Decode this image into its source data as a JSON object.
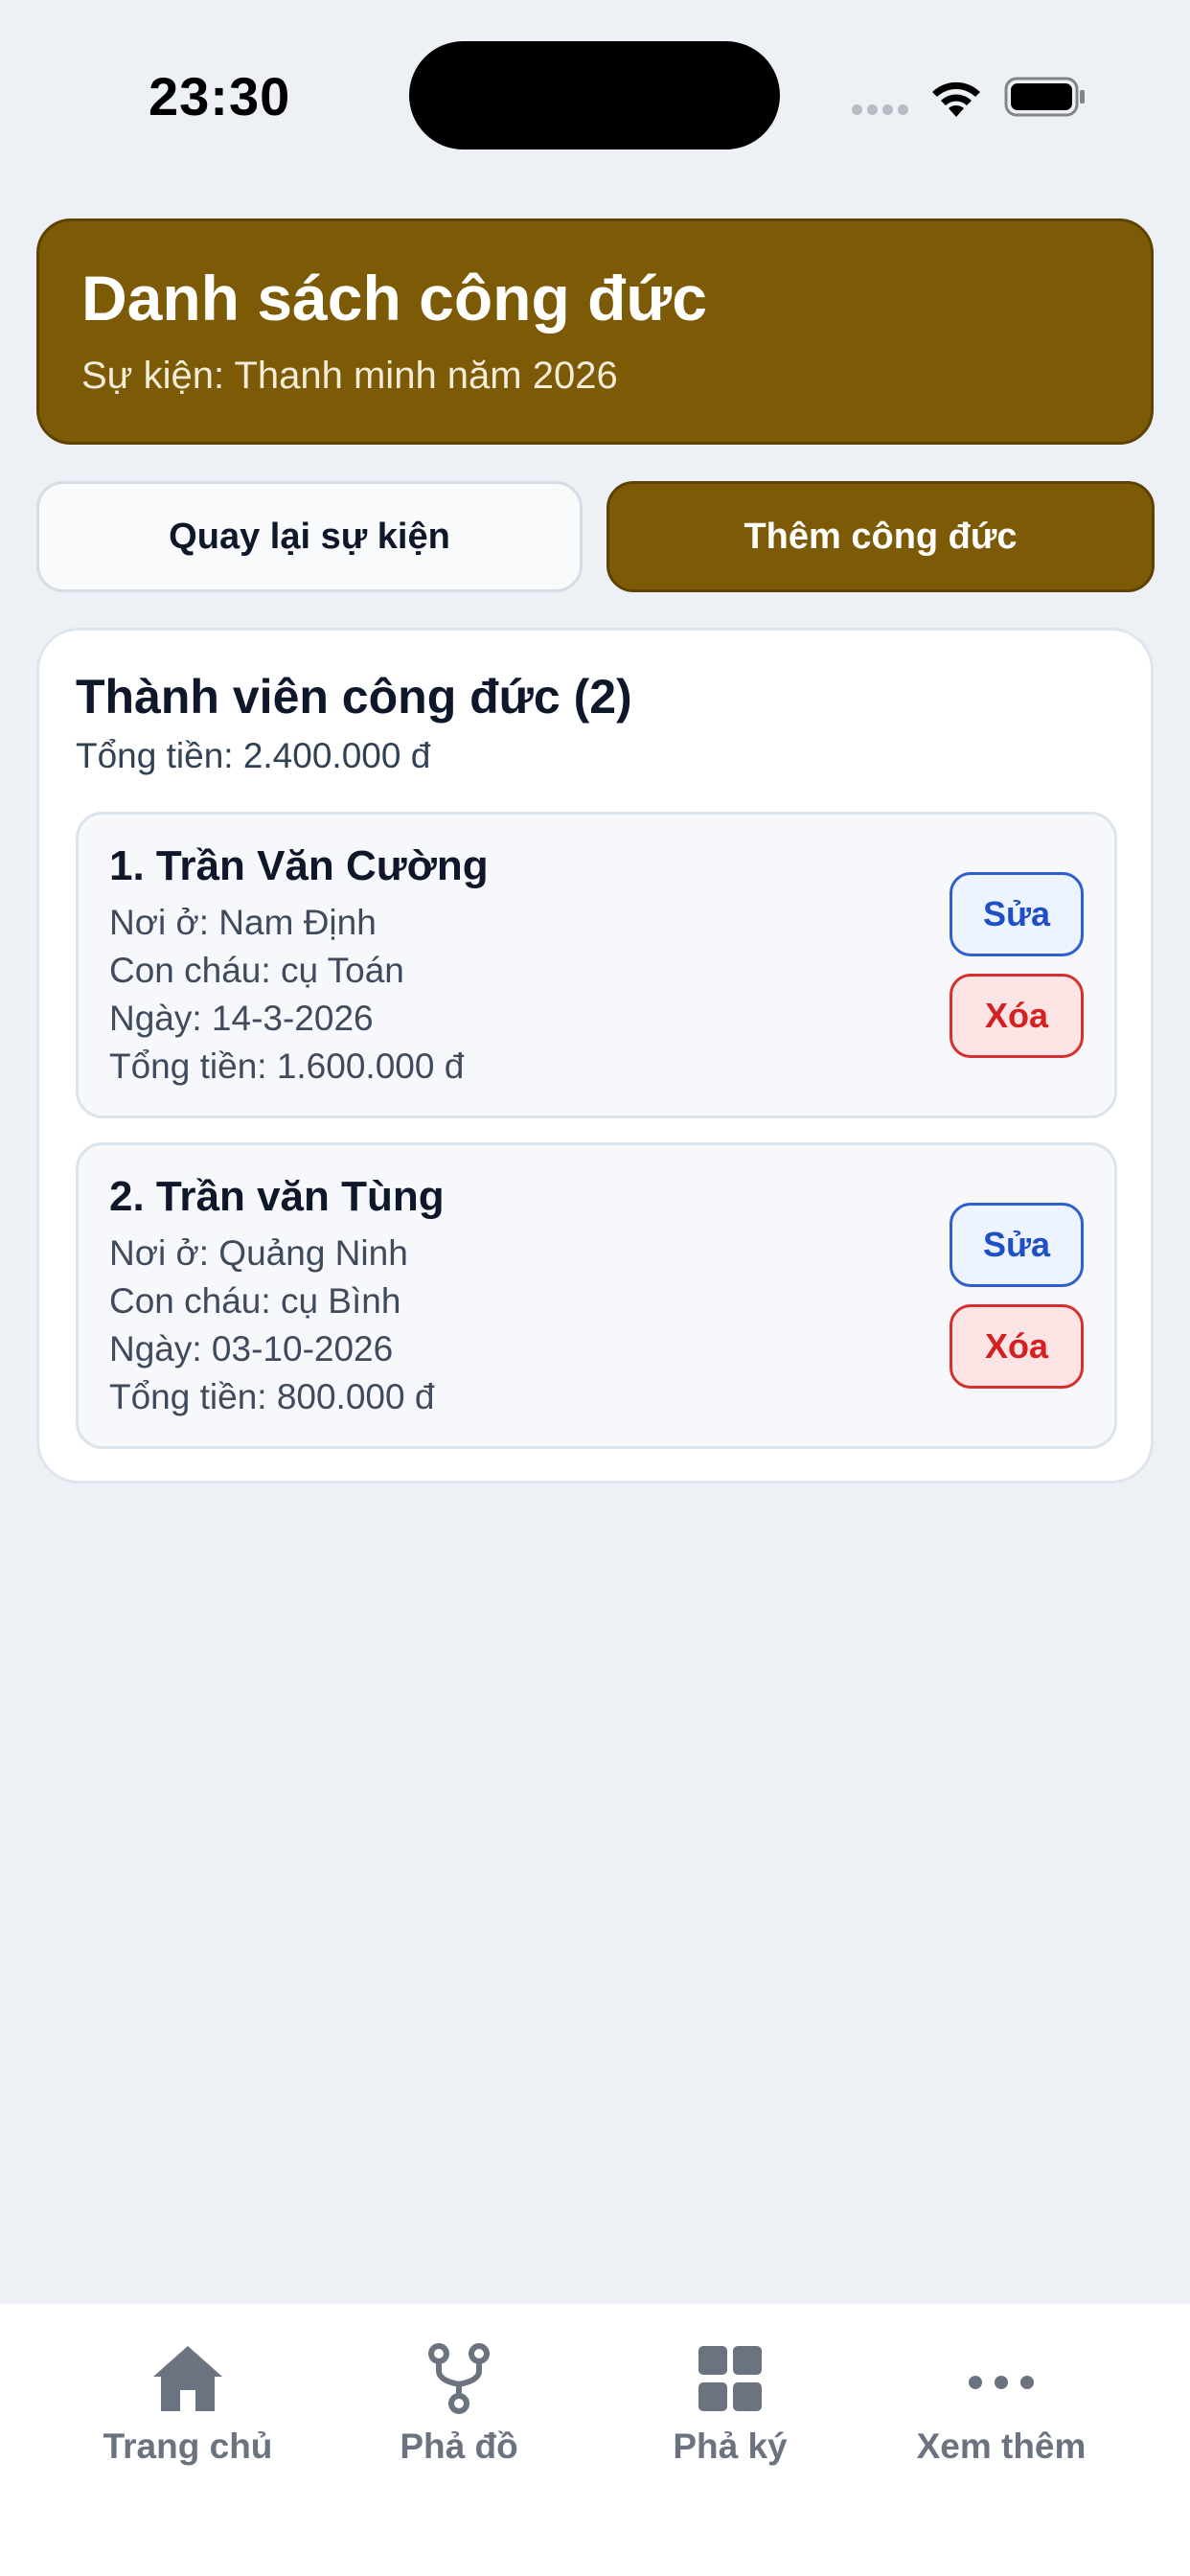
{
  "status_bar": {
    "time": "23:30",
    "icons": [
      "signal-dots-icon",
      "wifi-icon",
      "battery-icon"
    ]
  },
  "header": {
    "title": "Danh sách công đức",
    "subtitle": "Sự kiện: Thanh minh năm 2026"
  },
  "actions": {
    "back_label": "Quay lại sự kiện",
    "add_label": "Thêm công đức"
  },
  "members_card": {
    "title": "Thành viên công đức (2)",
    "total": "Tổng tiền: 2.400.000 đ",
    "items": [
      {
        "name": "1. Trần Văn Cường",
        "residence": "Nơi ở: Nam Định",
        "descendant": "Con cháu: cụ Toán",
        "date": "Ngày: 14-3-2026",
        "amount": "Tổng tiền: 1.600.000 đ",
        "edit_label": "Sửa",
        "delete_label": "Xóa"
      },
      {
        "name": "2. Trần văn Tùng",
        "residence": "Nơi ở: Quảng Ninh",
        "descendant": "Con cháu: cụ Bình",
        "date": "Ngày: 03-10-2026",
        "amount": "Tổng tiền: 800.000 đ",
        "edit_label": "Sửa",
        "delete_label": "Xóa"
      }
    ]
  },
  "bottom_nav": {
    "items": [
      {
        "label": "Trang chủ",
        "icon": "home-icon"
      },
      {
        "label": "Phả đồ",
        "icon": "family-tree-icon"
      },
      {
        "label": "Phả ký",
        "icon": "grid-icon"
      },
      {
        "label": "Xem thêm",
        "icon": "more-dots-icon"
      }
    ]
  },
  "colors": {
    "brand": "#7c5a06",
    "background": "#edf1f6",
    "edit": "#1e4fc4",
    "delete": "#d42020"
  }
}
